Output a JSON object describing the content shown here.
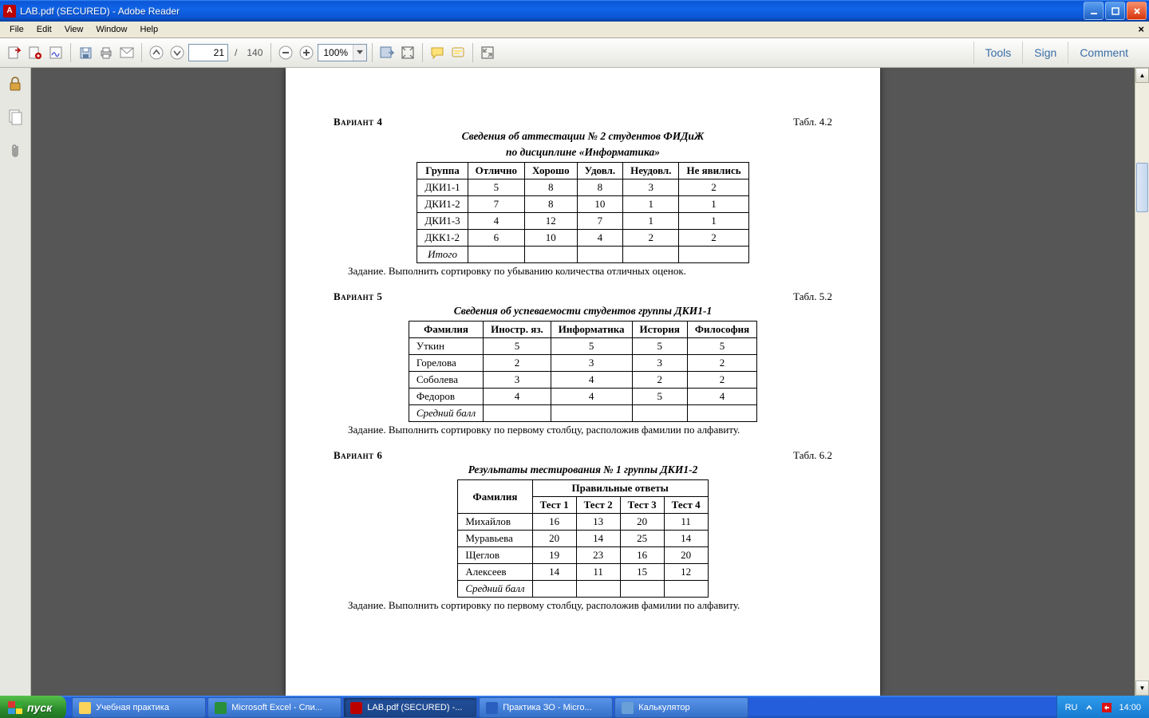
{
  "window": {
    "title": "LAB.pdf (SECURED) - Adobe Reader"
  },
  "menubar": {
    "items": [
      "File",
      "Edit",
      "View",
      "Window",
      "Help"
    ]
  },
  "toolbar": {
    "page_current": "21",
    "page_total": "140",
    "page_sep": "/",
    "zoom": "100%",
    "links": {
      "tools": "Tools",
      "sign": "Sign",
      "comment": "Comment"
    }
  },
  "document": {
    "v4": {
      "label": "Вариант 4",
      "tabl": "Табл. 4.2",
      "title1": "Сведения об аттестации № 2 студентов ФИДиЖ",
      "title2": "по дисциплине «Информатика»",
      "headers": [
        "Группа",
        "Отлично",
        "Хорошо",
        "Удовл.",
        "Неудовл.",
        "Не явились"
      ],
      "rows": [
        [
          "ДКИ1-1",
          "5",
          "8",
          "8",
          "3",
          "2"
        ],
        [
          "ДКИ1-2",
          "7",
          "8",
          "10",
          "1",
          "1"
        ],
        [
          "ДКИ1-3",
          "4",
          "12",
          "7",
          "1",
          "1"
        ],
        [
          "ДКК1-2",
          "6",
          "10",
          "4",
          "2",
          "2"
        ]
      ],
      "footer": "Итого",
      "task": "Задание. Выполнить сортировку по убыванию количества отличных оценок."
    },
    "v5": {
      "label": "Вариант 5",
      "tabl": "Табл. 5.2",
      "title1": "Сведения об успеваемости студентов группы ДКИ1-1",
      "headers": [
        "Фамилия",
        "Иностр. яз.",
        "Информатика",
        "История",
        "Философия"
      ],
      "rows": [
        [
          "Уткин",
          "5",
          "5",
          "5",
          "5"
        ],
        [
          "Горелова",
          "2",
          "3",
          "3",
          "2"
        ],
        [
          "Соболева",
          "3",
          "4",
          "2",
          "2"
        ],
        [
          "Федоров",
          "4",
          "4",
          "5",
          "4"
        ]
      ],
      "footer": "Средний балл",
      "task": "Задание. Выполнить сортировку по первому столбцу, расположив фамилии по алфавиту."
    },
    "v6": {
      "label": "Вариант 6",
      "tabl": "Табл. 6.2",
      "title1": "Результаты тестирования № 1 группы ДКИ1-2",
      "head_surname": "Фамилия",
      "head_group": "Правильные ответы",
      "sub_headers": [
        "Тест 1",
        "Тест 2",
        "Тест 3",
        "Тест 4"
      ],
      "rows": [
        [
          "Михайлов",
          "16",
          "13",
          "20",
          "11"
        ],
        [
          "Муравьева",
          "20",
          "14",
          "25",
          "14"
        ],
        [
          "Щеглов",
          "19",
          "23",
          "16",
          "20"
        ],
        [
          "Алексеев",
          "14",
          "11",
          "15",
          "12"
        ]
      ],
      "footer": "Средний балл",
      "task": "Задание. Выполнить сортировку по первому столбцу, расположив фамилии по алфавиту."
    }
  },
  "taskbar": {
    "start": "пуск",
    "items": [
      {
        "label": "Учебная практика",
        "color": "#f9d35a"
      },
      {
        "label": "Microsoft Excel - Спи...",
        "color": "#2a8f3a"
      },
      {
        "label": "LAB.pdf (SECURED) -...",
        "color": "#b00",
        "active": true
      },
      {
        "label": "Практика ЗО - Micro...",
        "color": "#2a5fbf"
      },
      {
        "label": "Калькулятор",
        "color": "#6aa0d8"
      }
    ],
    "tray": {
      "lang": "RU",
      "time": "14:00"
    }
  }
}
